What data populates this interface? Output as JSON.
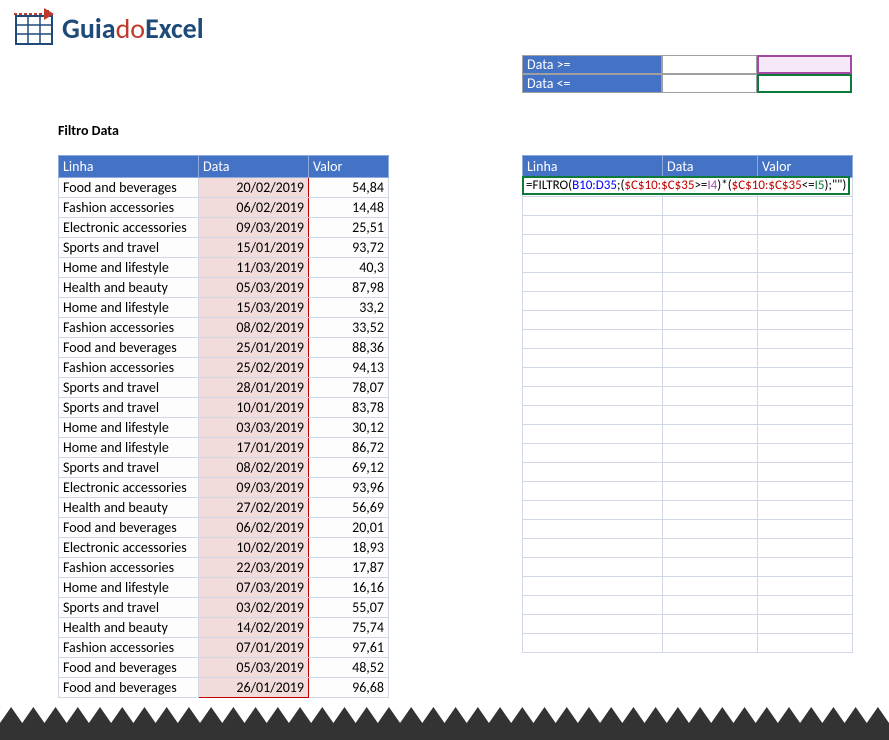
{
  "logo": {
    "part1": "Guia",
    "part2": "do",
    "part3": "Excel"
  },
  "title": "Filtro Data",
  "filter": {
    "label1": "Data >=",
    "label2": "Data <="
  },
  "headers": {
    "linha": "Linha",
    "data": "Data",
    "valor": "Valor"
  },
  "formula": {
    "p1": "=FILTRO(",
    "p2": "B10:D35",
    "p3": ";(",
    "p4": "$C$10:$C$35",
    "p5": ">=",
    "p6": "I4",
    "p7": ")*(",
    "p8": "$C$10:$C$35",
    "p9": "<=",
    "p10": "I5",
    "p11": ");\"\")"
  },
  "rows": [
    {
      "linha": "Food and beverages",
      "data": "20/02/2019",
      "valor": "54,84"
    },
    {
      "linha": "Fashion accessories",
      "data": "06/02/2019",
      "valor": "14,48"
    },
    {
      "linha": "Electronic accessories",
      "data": "09/03/2019",
      "valor": "25,51"
    },
    {
      "linha": "Sports and travel",
      "data": "15/01/2019",
      "valor": "93,72"
    },
    {
      "linha": "Home and lifestyle",
      "data": "11/03/2019",
      "valor": "40,3"
    },
    {
      "linha": "Health and beauty",
      "data": "05/03/2019",
      "valor": "87,98"
    },
    {
      "linha": "Home and lifestyle",
      "data": "15/03/2019",
      "valor": "33,2"
    },
    {
      "linha": "Fashion accessories",
      "data": "08/02/2019",
      "valor": "33,52"
    },
    {
      "linha": "Food and beverages",
      "data": "25/01/2019",
      "valor": "88,36"
    },
    {
      "linha": "Fashion accessories",
      "data": "25/02/2019",
      "valor": "94,13"
    },
    {
      "linha": "Sports and travel",
      "data": "28/01/2019",
      "valor": "78,07"
    },
    {
      "linha": "Sports and travel",
      "data": "10/01/2019",
      "valor": "83,78"
    },
    {
      "linha": "Home and lifestyle",
      "data": "03/03/2019",
      "valor": "30,12"
    },
    {
      "linha": "Home and lifestyle",
      "data": "17/01/2019",
      "valor": "86,72"
    },
    {
      "linha": "Sports and travel",
      "data": "08/02/2019",
      "valor": "69,12"
    },
    {
      "linha": "Electronic accessories",
      "data": "09/03/2019",
      "valor": "93,96"
    },
    {
      "linha": "Health and beauty",
      "data": "27/02/2019",
      "valor": "56,69"
    },
    {
      "linha": "Food and beverages",
      "data": "06/02/2019",
      "valor": "20,01"
    },
    {
      "linha": "Electronic accessories",
      "data": "10/02/2019",
      "valor": "18,93"
    },
    {
      "linha": "Fashion accessories",
      "data": "22/03/2019",
      "valor": "17,87"
    },
    {
      "linha": "Home and lifestyle",
      "data": "07/03/2019",
      "valor": "16,16"
    },
    {
      "linha": "Sports and travel",
      "data": "03/02/2019",
      "valor": "55,07"
    },
    {
      "linha": "Health and beauty",
      "data": "14/02/2019",
      "valor": "75,74"
    },
    {
      "linha": "Fashion accessories",
      "data": "07/01/2019",
      "valor": "97,61"
    },
    {
      "linha": "Food and beverages",
      "data": "05/03/2019",
      "valor": "48,52"
    },
    {
      "linha": "Food and beverages",
      "data": "26/01/2019",
      "valor": "96,68"
    }
  ],
  "result_empty_rows": 25
}
